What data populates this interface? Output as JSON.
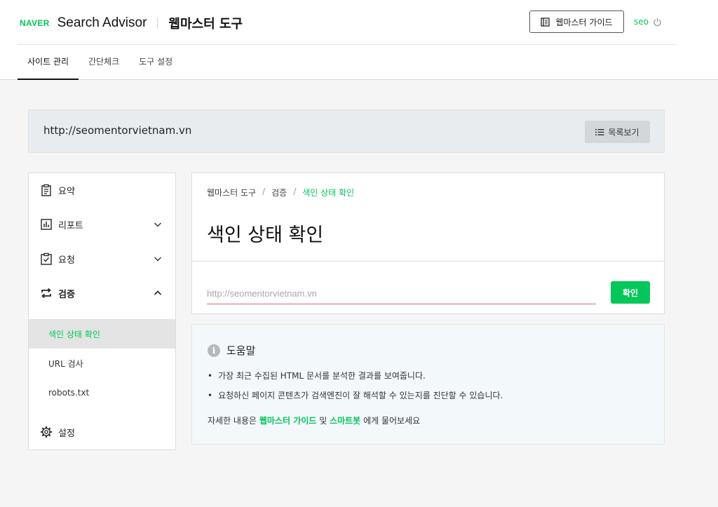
{
  "header": {
    "brand_naver": "NAVER",
    "brand_product": "Search Advisor",
    "tool_title": "웹마스터 도구",
    "guide_button": "웹마스터 가이드",
    "user": "seo"
  },
  "tabs": [
    {
      "label": "사이트 관리",
      "active": true
    },
    {
      "label": "간단체크",
      "active": false
    },
    {
      "label": "도구 설정",
      "active": false
    }
  ],
  "site": {
    "url": "http://seomentorvietnam.vn",
    "list_button": "목록보기"
  },
  "sidebar": {
    "items": [
      {
        "label": "요약",
        "icon": "clipboard-icon"
      },
      {
        "label": "리포트",
        "icon": "chart-icon",
        "expandable": true
      },
      {
        "label": "요청",
        "icon": "check-clipboard-icon",
        "expandable": true
      },
      {
        "label": "검증",
        "icon": "repeat-icon",
        "expanded": true
      },
      {
        "label": "설정",
        "icon": "gear-icon"
      }
    ],
    "sub_items": [
      {
        "label": "색인 상태 확인",
        "active": true
      },
      {
        "label": "URL 검사",
        "active": false
      },
      {
        "label": "robots.txt",
        "active": false
      }
    ]
  },
  "breadcrumb": [
    "웹마스터 도구",
    "검증",
    "색인 상태 확인"
  ],
  "page_title": "색인 상태 확인",
  "url_input": {
    "value": "",
    "placeholder": "http://seomentorvietnam.vn"
  },
  "confirm_button": "확인",
  "help": {
    "title": "도움말",
    "bullets": [
      "가장 최근 수집된 HTML 문서를 분석한 결과를 보여줍니다.",
      "요청하신 페이지 콘텐츠가 검색엔진이 잘 해석할 수 있는지를 진단할 수 있습니다."
    ],
    "footer_prefix": "자세한 내용은",
    "footer_link1": "웹마스터 가이드",
    "footer_mid": "및",
    "footer_link2": "스마트봇",
    "footer_suffix": "에게 물어보세요"
  },
  "colors": {
    "accent": "#03c75a",
    "input_underline": "#e66b6b",
    "help_bg": "#f3f8fb"
  }
}
